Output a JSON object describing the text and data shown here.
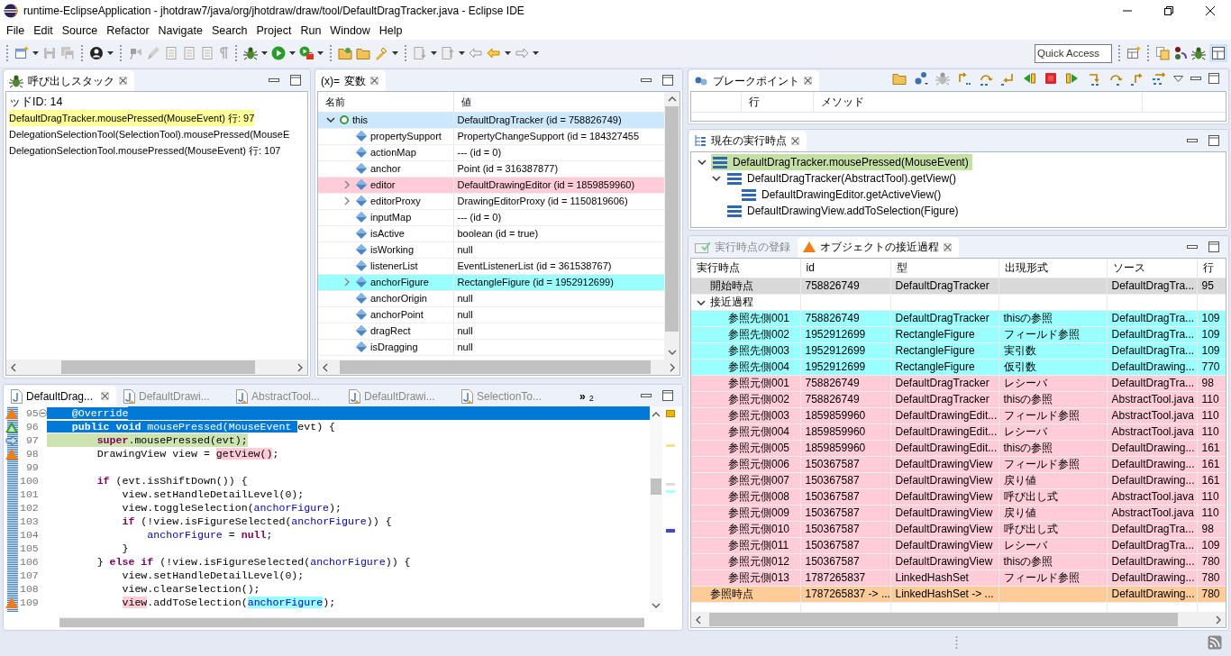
{
  "window": {
    "title": "runtime-EclipseApplication - jhotdraw7/java/org/jhotdraw/draw/tool/DefaultDragTracker.java - Eclipse IDE"
  },
  "menu": [
    "File",
    "Edit",
    "Source",
    "Refactor",
    "Navigate",
    "Search",
    "Project",
    "Run",
    "Window",
    "Help"
  ],
  "quick_access": {
    "placeholder": "Quick Access"
  },
  "call_stack": {
    "title": "呼び出しスタック",
    "lines": [
      {
        "text": "ッドID: 14"
      },
      {
        "text": "DefaultDragTracker.mousePressed(MouseEvent) 行: 97",
        "color": "#ffff99"
      },
      {
        "text": "DelegationSelectionTool(SelectionTool).mousePressed(MouseE"
      },
      {
        "text": "DelegationSelectionTool.mousePressed(MouseEvent) 行: 107"
      }
    ]
  },
  "variables": {
    "title": "変数",
    "icon": "(x)=",
    "columns": [
      "名前",
      "値"
    ],
    "rows": [
      {
        "name": "this",
        "value": "DefaultDragTracker (id = 758826749)",
        "expanded": true,
        "color": "#cce8ff",
        "children": [
          {
            "name": "propertySupport",
            "value": "PropertyChangeSupport (id = 184327455"
          },
          {
            "name": "actionMap",
            "value": "--- (id = 0)"
          },
          {
            "name": "anchor",
            "value": "Point (id = 316387877)"
          },
          {
            "name": "editor",
            "value": "DefaultDrawingEditor (id = 1859859960)",
            "expanded": false,
            "color": "#ffccd7"
          },
          {
            "name": "editorProxy",
            "value": "DrawingEditorProxy (id = 1150819606)",
            "expanded": false
          },
          {
            "name": "inputMap",
            "value": "--- (id = 0)"
          },
          {
            "name": "isActive",
            "value": "boolean (id = true)"
          },
          {
            "name": "isWorking",
            "value": "null"
          },
          {
            "name": "listenerList",
            "value": "EventListenerList (id = 361538767)"
          },
          {
            "name": "anchorFigure",
            "value": "RectangleFigure (id = 1952912699)",
            "expanded": false,
            "color": "#99ffff"
          },
          {
            "name": "anchorOrigin",
            "value": "null"
          },
          {
            "name": "anchorPoint",
            "value": "null"
          },
          {
            "name": "dragRect",
            "value": "null"
          },
          {
            "name": "isDragging",
            "value": "null"
          }
        ]
      }
    ]
  },
  "breakpoints": {
    "title": "ブレークポイント",
    "columns": [
      "行",
      "メソッド"
    ]
  },
  "execution_point": {
    "title": "現在の実行時点",
    "tree": [
      {
        "label": "DefaultDragTracker.mousePressed(MouseEvent)",
        "color": "#c5e0a5",
        "expanded": true,
        "children": [
          {
            "label": "DefaultDragTracker(AbstractTool).getView()",
            "expanded": true,
            "children": [
              {
                "label": "DefaultDrawingEditor.getActiveView()"
              }
            ]
          },
          {
            "label": "DefaultDrawingView.addToSelection(Figure)"
          }
        ]
      }
    ]
  },
  "bottom_tabs": [
    {
      "label": "実行時点の登録",
      "selected": false
    },
    {
      "label": "オブジェクトの接近過程",
      "selected": true
    }
  ],
  "access_table": {
    "columns": [
      "実行時点",
      "id",
      "型",
      "出現形式",
      "ソース",
      "行"
    ],
    "rows": [
      {
        "time_point": "開始時点",
        "id": "758826749",
        "type": "DefaultDragTracker",
        "source": "DefaultDragTra...",
        "line": "95",
        "color": "#d9d9d9"
      },
      {
        "time_point": "接近過程",
        "expanded": true,
        "children": [
          {
            "time_point": "参照先側001",
            "id": "758826749",
            "type": "DefaultDragTracker",
            "form": "thisの参照",
            "source": "DefaultDragTra...",
            "line": "109",
            "color": "#99ffff"
          },
          {
            "time_point": "参照先側002",
            "id": "1952912699",
            "type": "RectangleFigure",
            "form": "フィールド参照",
            "source": "DefaultDragTra...",
            "line": "109",
            "color": "#99ffff"
          },
          {
            "time_point": "参照先側003",
            "id": "1952912699",
            "type": "RectangleFigure",
            "form": "実引数",
            "source": "DefaultDragTra...",
            "line": "109",
            "color": "#99ffff"
          },
          {
            "time_point": "参照先側004",
            "id": "1952912699",
            "type": "RectangleFigure",
            "form": "仮引数",
            "source": "DefaultDrawing...",
            "line": "770",
            "color": "#99ffff"
          },
          {
            "time_point": "参照元側001",
            "id": "758826749",
            "type": "DefaultDragTracker",
            "form": "レシーバ",
            "source": "DefaultDragTra...",
            "line": "98",
            "color": "#ffccd7"
          },
          {
            "time_point": "参照元側002",
            "id": "758826749",
            "type": "DefaultDragTracker",
            "form": "thisの参照",
            "source": "AbstractTool.java",
            "line": "110",
            "color": "#ffccd7"
          },
          {
            "time_point": "参照元側003",
            "id": "1859859960",
            "type": "DefaultDrawingEdit...",
            "form": "フィールド参照",
            "source": "AbstractTool.java",
            "line": "110",
            "color": "#ffccd7"
          },
          {
            "time_point": "参照元側004",
            "id": "1859859960",
            "type": "DefaultDrawingEdit...",
            "form": "レシーバ",
            "source": "AbstractTool.java",
            "line": "110",
            "color": "#ffccd7"
          },
          {
            "time_point": "参照元側005",
            "id": "1859859960",
            "type": "DefaultDrawingEdit...",
            "form": "thisの参照",
            "source": "DefaultDrawing...",
            "line": "161",
            "color": "#ffccd7"
          },
          {
            "time_point": "参照元側006",
            "id": "150367587",
            "type": "DefaultDrawingView",
            "form": "フィールド参照",
            "source": "DefaultDrawing...",
            "line": "161",
            "color": "#ffccd7"
          },
          {
            "time_point": "参照元側007",
            "id": "150367587",
            "type": "DefaultDrawingView",
            "form": "戻り値",
            "source": "DefaultDrawing...",
            "line": "161",
            "color": "#ffccd7"
          },
          {
            "time_point": "参照元側008",
            "id": "150367587",
            "type": "DefaultDrawingView",
            "form": "呼び出し式",
            "source": "AbstractTool.java",
            "line": "110",
            "color": "#ffccd7"
          },
          {
            "time_point": "参照元側009",
            "id": "150367587",
            "type": "DefaultDrawingView",
            "form": "戻り値",
            "source": "AbstractTool.java",
            "line": "110",
            "color": "#ffccd7"
          },
          {
            "time_point": "参照元側010",
            "id": "150367587",
            "type": "DefaultDrawingView",
            "form": "呼び出し式",
            "source": "DefaultDragTra...",
            "line": "98",
            "color": "#ffccd7"
          },
          {
            "time_point": "参照元側011",
            "id": "150367587",
            "type": "DefaultDrawingView",
            "form": "レシーバ",
            "source": "DefaultDragTra...",
            "line": "109",
            "color": "#ffccd7"
          },
          {
            "time_point": "参照元側012",
            "id": "150367587",
            "type": "DefaultDrawingView",
            "form": "thisの参照",
            "source": "DefaultDrawing...",
            "line": "780",
            "color": "#ffccd7"
          },
          {
            "time_point": "参照元側013",
            "id": "1787265837",
            "type": "LinkedHashSet",
            "form": "フィールド参照",
            "source": "DefaultDrawing...",
            "line": "780",
            "color": "#ffccd7"
          }
        ]
      },
      {
        "time_point": "参照時点",
        "id": "1787265837 -> ...",
        "type": "LinkedHashSet -> ...",
        "source": "DefaultDrawing...",
        "line": "780",
        "color": "#ffcc99"
      }
    ]
  },
  "editor": {
    "tabs": [
      {
        "label": "DefaultDrag...",
        "selected": true
      },
      {
        "label": "DefaultDrawi...",
        "selected": false
      },
      {
        "label": "AbstractTool...",
        "selected": false
      },
      {
        "label": "DefaultDrawi...",
        "selected": false
      },
      {
        "label": "SelectionTo...",
        "selected": false
      }
    ],
    "overflow": {
      "text": "»",
      "count": "2"
    },
    "lines": [
      {
        "number": "95",
        "kind": "triangle",
        "foldable": true,
        "selected_to_end": true,
        "tokens": [
          {
            "text": "    @Override",
            "kind": "annotation",
            "selected": true
          }
        ]
      },
      {
        "number": "96",
        "kind": "up-triangle",
        "tokens": [
          {
            "text": "    public void",
            "kind": "keyword",
            "selected": true
          },
          {
            "text": " mousePressed(MouseEvent ",
            "kind": "plain",
            "selected": true
          },
          {
            "text": "evt) {",
            "kind": "plain"
          }
        ]
      },
      {
        "number": "97",
        "kind": "arrow",
        "color": "#cde3b0",
        "tokens": [
          {
            "text": "        super",
            "kind": "keyword"
          },
          {
            "text": ".mousePressed(evt);",
            "kind": "plain"
          }
        ]
      },
      {
        "number": "98",
        "kind": "triangle",
        "tokens": [
          {
            "text": "        DrawingView view = ",
            "kind": "plain"
          },
          {
            "text": "getView()",
            "kind": "plain",
            "color": "#ffccd7"
          },
          {
            "text": ";",
            "kind": "plain"
          }
        ]
      },
      {
        "number": "99"
      },
      {
        "number": "100",
        "tokens": [
          {
            "text": "        if",
            "kind": "keyword"
          },
          {
            "text": " (evt.isShiftDown()) {",
            "kind": "plain"
          }
        ]
      },
      {
        "number": "101",
        "tokens": [
          {
            "text": "            view.setHandleDetailLevel(0);",
            "kind": "plain"
          }
        ]
      },
      {
        "number": "102",
        "tokens": [
          {
            "text": "            view.toggleSelection(",
            "kind": "plain"
          },
          {
            "text": "anchorFigure",
            "kind": "field"
          },
          {
            "text": ");",
            "kind": "plain"
          }
        ]
      },
      {
        "number": "103",
        "tokens": [
          {
            "text": "            if",
            "kind": "keyword"
          },
          {
            "text": " (!view.isFigureSelected(",
            "kind": "plain"
          },
          {
            "text": "anchorFigure",
            "kind": "field"
          },
          {
            "text": ")) {",
            "kind": "plain"
          }
        ]
      },
      {
        "number": "104",
        "tokens": [
          {
            "text": "                anchorFigure",
            "kind": "field"
          },
          {
            "text": " = ",
            "kind": "plain"
          },
          {
            "text": "null",
            "kind": "keyword"
          },
          {
            "text": ";",
            "kind": "plain"
          }
        ]
      },
      {
        "number": "105",
        "tokens": [
          {
            "text": "            }",
            "kind": "plain"
          }
        ]
      },
      {
        "number": "106",
        "tokens": [
          {
            "text": "        } ",
            "kind": "plain"
          },
          {
            "text": "else if",
            "kind": "keyword"
          },
          {
            "text": " (!view.isFigureSelected(",
            "kind": "plain"
          },
          {
            "text": "anchorFigure",
            "kind": "field"
          },
          {
            "text": ")) {",
            "kind": "plain"
          }
        ]
      },
      {
        "number": "107",
        "tokens": [
          {
            "text": "            view.setHandleDetailLevel(0);",
            "kind": "plain"
          }
        ]
      },
      {
        "number": "108",
        "tokens": [
          {
            "text": "            view.clearSelection();",
            "kind": "plain"
          }
        ]
      },
      {
        "number": "109",
        "kind": "triangle",
        "tokens": [
          {
            "text": "            view",
            "kind": "plain",
            "color": "#ffccd7"
          },
          {
            "text": ".addToSelection(",
            "kind": "plain"
          },
          {
            "text": "anchorFigure",
            "kind": "field",
            "color": "#99ffff"
          },
          {
            "text": ");",
            "kind": "plain"
          }
        ]
      }
    ]
  }
}
